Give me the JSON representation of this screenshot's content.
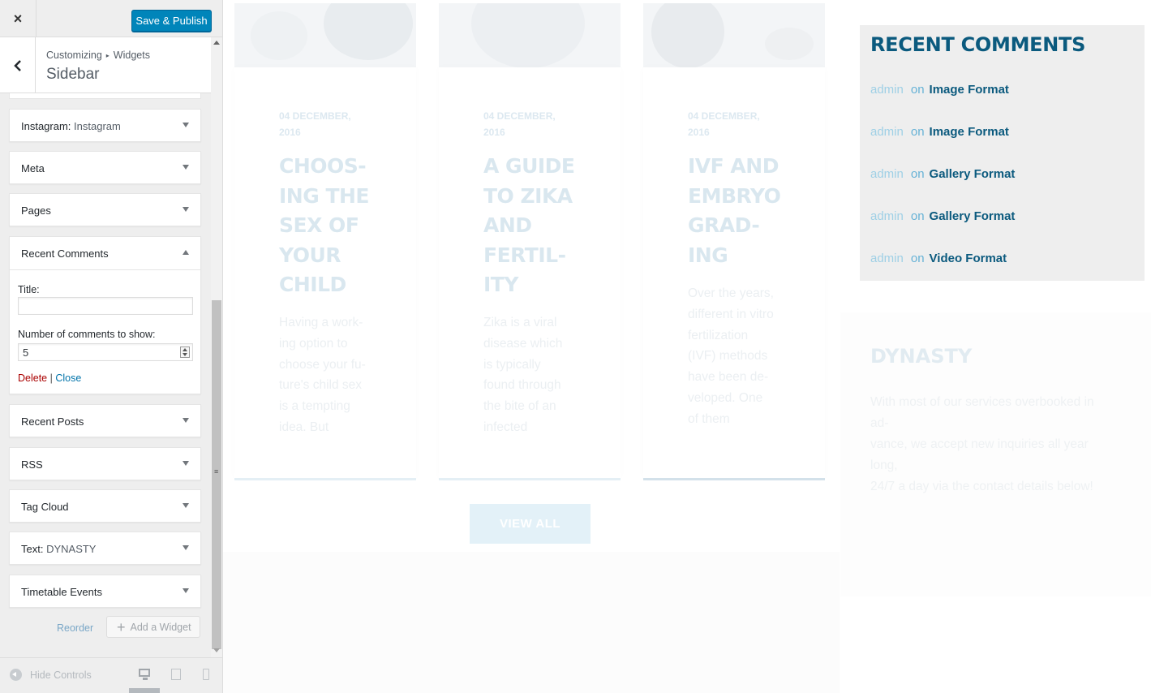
{
  "customizer": {
    "close_label": "×",
    "save_label": "Save & Publish",
    "breadcrumb": {
      "root": "Customizing",
      "separator": "▸",
      "parent": "Widgets"
    },
    "section_title": "Sidebar",
    "widgets": [
      {
        "title": "Instagram:",
        "subtitle": " Instagram"
      },
      {
        "title": "Meta",
        "subtitle": ""
      },
      {
        "title": "Pages",
        "subtitle": ""
      },
      {
        "title": "Recent Posts",
        "subtitle": ""
      },
      {
        "title": "RSS",
        "subtitle": ""
      },
      {
        "title": "Tag Cloud",
        "subtitle": ""
      },
      {
        "title": "Text:",
        "subtitle": " DYNASTY"
      },
      {
        "title": "Timetable Events",
        "subtitle": ""
      }
    ],
    "open_widget": {
      "title": "Recent Comments",
      "title_field_label": "Title:",
      "title_field_value": "",
      "count_field_label": "Number of comments to show:",
      "count_field_value": "5",
      "delete_label": "Delete",
      "separator": "|",
      "close_label": "Close"
    },
    "reorder_label": "Reorder",
    "add_widget_label": "Add a Widget",
    "hide_controls_label": "Hide Controls"
  },
  "preview": {
    "posts": [
      {
        "date": "04 December, 2016",
        "title": "Choos-\ning the\nsex of\nyour\nchild",
        "excerpt": "Having a work-\ning option to\nchoose your fu-\nture's child sex\nis a tempting\nidea. But"
      },
      {
        "date": "04 December, 2016",
        "title": "A guide\nto Zika\nand\nfertil-\nity",
        "excerpt": "Zika is a viral\ndisease which\nis typically\nfound through\nthe bite of an\ninfected"
      },
      {
        "date": "04 December, 2016",
        "title": "IVF and\nembryo\ngrad-\ning",
        "excerpt": "Over the years,\ndifferent in vitro\nfertilization\n(IVF) methods\nhave been de-\nveloped. One\nof them"
      }
    ],
    "view_all_label": "VIEW ALL",
    "recent_comments": {
      "title": "RECENT COMMENTS",
      "items": [
        {
          "author": "admin",
          "on": "on",
          "post": "Image Format"
        },
        {
          "author": "admin",
          "on": "on",
          "post": "Image Format"
        },
        {
          "author": "admin",
          "on": "on",
          "post": "Gallery Format"
        },
        {
          "author": "admin",
          "on": "on",
          "post": "Gallery Format"
        },
        {
          "author": "admin",
          "on": "on",
          "post": "Video Format"
        }
      ]
    },
    "dynasty": {
      "title": "DYNASTY",
      "text": "With most of our services overbooked in ad-\nvance, we accept new inquiries all year long,\n24/7 a day via the contact details below!"
    }
  },
  "colors": {
    "primary_button": "#0085ba",
    "brand_dark": "#0b5a7e",
    "link_light": "#66b2d6",
    "delete_red": "#a00"
  }
}
